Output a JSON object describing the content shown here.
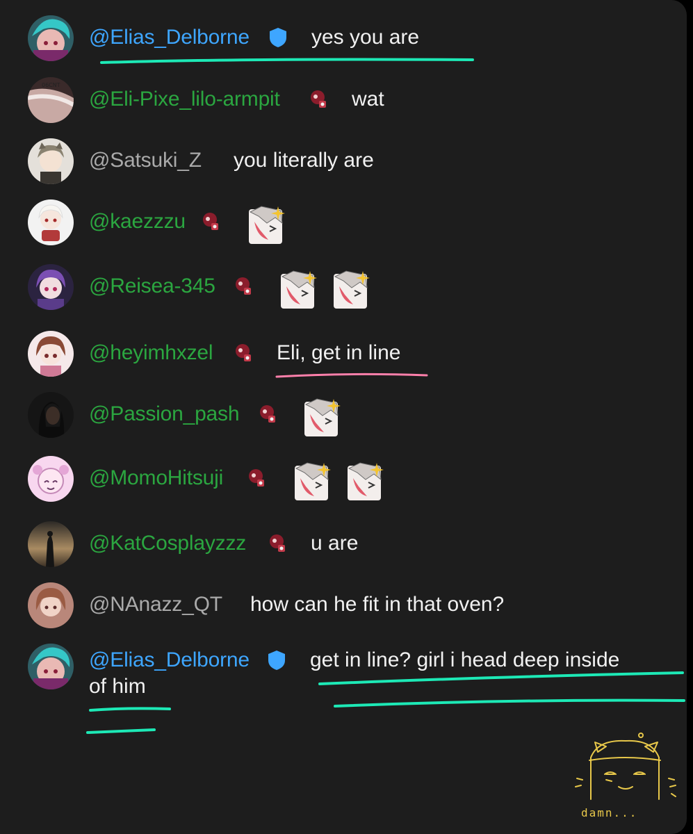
{
  "comments": [
    {
      "username": "@Elias_Delborne",
      "style": "blue",
      "badge": "verified",
      "text": "yes you are",
      "emotes": 0,
      "avatar": "anime-cyan-hair"
    },
    {
      "username": "@Eli-Pixe_lilo-armpit",
      "style": "green",
      "badge": "member",
      "text": "wat",
      "emotes": 0,
      "avatar": "photo-arm"
    },
    {
      "username": "@Satsuki_Z",
      "style": "gray",
      "badge": "",
      "text": "you literally are",
      "emotes": 0,
      "avatar": "anime-gray-hair"
    },
    {
      "username": "@kaezzzu",
      "style": "green",
      "badge": "member",
      "text": "",
      "emotes": 1,
      "avatar": "chibi-white"
    },
    {
      "username": "@Reisea-345",
      "style": "green",
      "badge": "member",
      "text": "",
      "emotes": 2,
      "avatar": "anime-purple-hair"
    },
    {
      "username": "@heyimhxzel",
      "style": "green",
      "badge": "member",
      "text": "Eli, get in line",
      "emotes": 0,
      "avatar": "anime-brown-hair"
    },
    {
      "username": "@Passion_pash",
      "style": "green",
      "badge": "member",
      "text": "",
      "emotes": 1,
      "avatar": "photo-dark"
    },
    {
      "username": "@MomoHitsuji",
      "style": "green",
      "badge": "member",
      "text": "",
      "emotes": 2,
      "avatar": "pastel-sheep"
    },
    {
      "username": "@KatCosplayzzz",
      "style": "green",
      "badge": "member",
      "text": "u are",
      "emotes": 0,
      "avatar": "photo-sunset"
    },
    {
      "username": "@NAnazz_QT",
      "style": "gray",
      "badge": "",
      "text": "how can he fit in that oven?",
      "emotes": 0,
      "avatar": "anime-warm"
    },
    {
      "username": "@Elias_Delborne",
      "style": "blue",
      "badge": "verified",
      "text": "get in line? girl i head deep inside",
      "text2": "of him",
      "emotes": 0,
      "avatar": "anime-cyan-hair"
    }
  ],
  "doodle": {
    "caption": "damn..."
  },
  "colors": {
    "background": "#1d1d1d",
    "verified_name": "#3ea6ff",
    "member_name": "#2ba640",
    "plain_name": "#aaaaaa",
    "text": "#f1f1f1",
    "underline_teal": "#1de9b6",
    "underline_pink": "#ff80ab",
    "doodle": "#e8c84a"
  }
}
